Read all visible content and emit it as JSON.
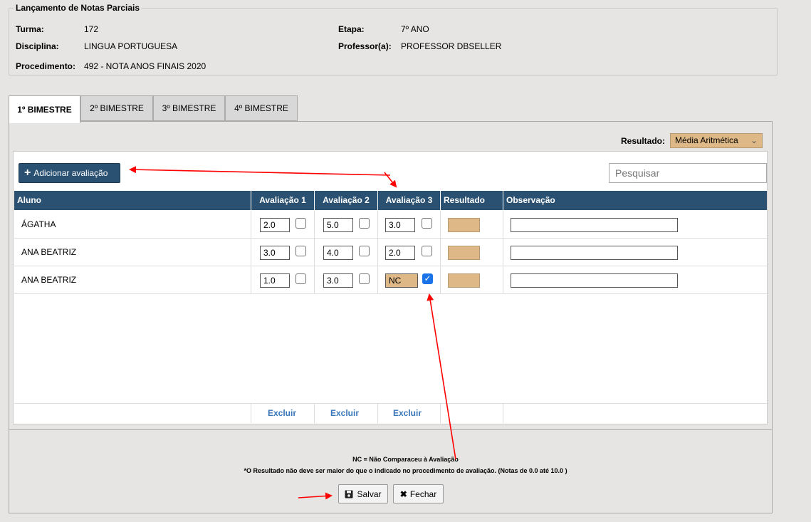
{
  "info": {
    "legend": "Lançamento de Notas Parciais",
    "turma_label": "Turma:",
    "turma_value": "172",
    "etapa_label": "Etapa:",
    "etapa_value": "7º ANO",
    "disciplina_label": "Disciplina:",
    "disciplina_value": "LINGUA PORTUGUESA",
    "professor_label": "Professor(a):",
    "professor_value": "PROFESSOR DBSELLER",
    "procedimento_label": "Procedimento:",
    "procedimento_value": "492 - NOTA ANOS FINAIS 2020"
  },
  "tabs": [
    "1º BIMESTRE",
    "2º BIMESTRE",
    "3º BIMESTRE",
    "4º BIMESTRE"
  ],
  "resultado": {
    "label": "Resultado:",
    "selected": "Média Aritmética",
    "chevron": "⌄"
  },
  "toolbar": {
    "add_label": "Adicionar avaliação",
    "add_icon": "+",
    "search_placeholder": "Pesquisar"
  },
  "table": {
    "headers": [
      "Aluno",
      "Avaliação 1",
      "Avaliação 2",
      "Avaliação 3",
      "Resultado",
      "Observação"
    ],
    "rows": [
      {
        "name": "ÁGATHA",
        "g1": "2.0",
        "g2": "5.0",
        "g3": "3.0",
        "c3": false
      },
      {
        "name": "ANA BEATRIZ",
        "g1": "3.0",
        "g2": "4.0",
        "g3": "2.0",
        "c3": false
      },
      {
        "name": "ANA BEATRIZ",
        "g1": "1.0",
        "g2": "3.0",
        "g3": "NC",
        "c3": true
      }
    ],
    "delete_label": "Excluir"
  },
  "notes": {
    "nc": "NC = Não Comparaceu à Avaliação",
    "result": "*O Resultado não deve ser maior do que o indicado no procedimento de avaliação. (Notas de 0.0 até 10.0 )"
  },
  "buttons": {
    "save": "Salvar",
    "close": "Fechar",
    "close_icon": "✖",
    "check_icon": "✓"
  },
  "colors": {
    "header": "#2b5172",
    "result": "#deb887",
    "link": "#3a77b7",
    "annotation": "#ff0000"
  }
}
